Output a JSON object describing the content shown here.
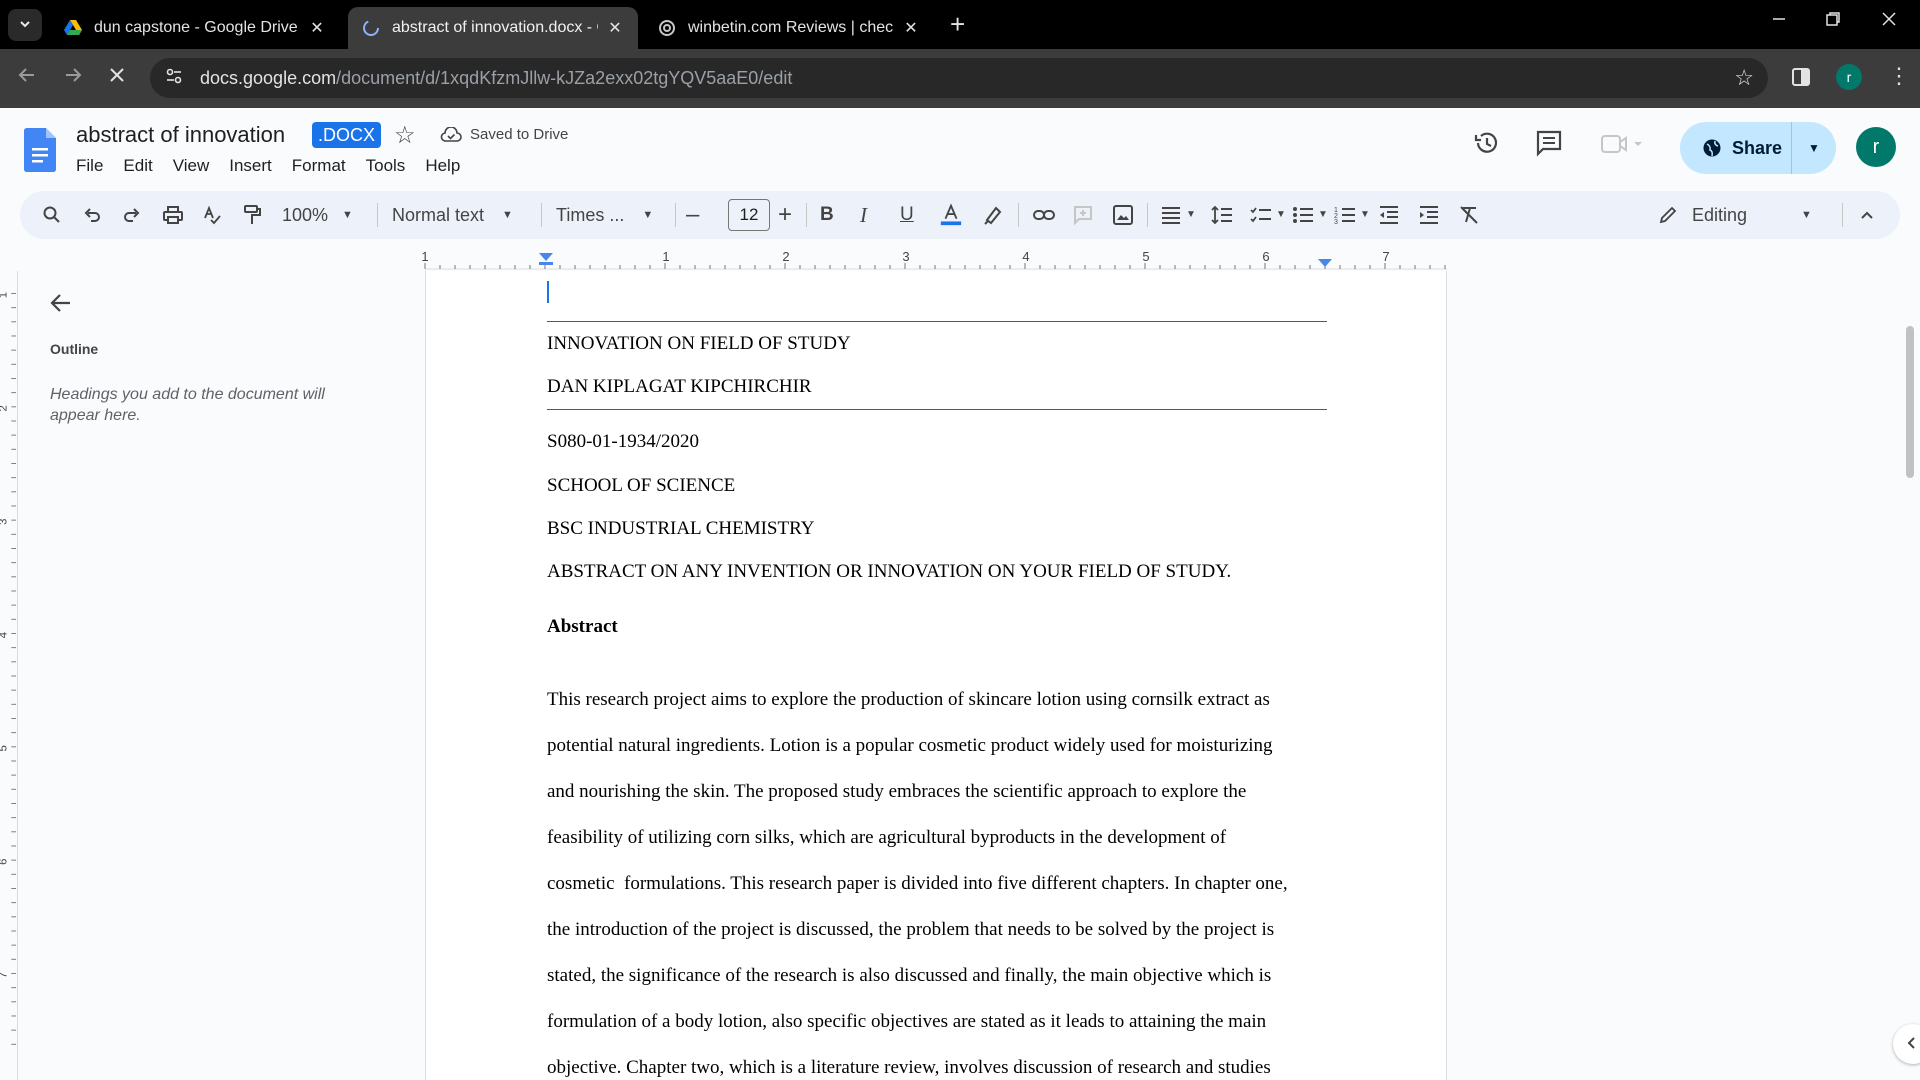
{
  "browser": {
    "tabs": [
      {
        "title": "dun capstone - Google Drive",
        "active": false
      },
      {
        "title": "abstract of innovation.docx - Google Docs",
        "active": true
      },
      {
        "title": "winbetin.com Reviews | check if site is scam or legit",
        "active": false
      }
    ],
    "url_host": "docs.google.com",
    "url_path": "/document/d/1xqdKfzmJllw-kJZa2exx02tgYQV5aaE0/edit",
    "profile_initial": "r"
  },
  "doc_header": {
    "title": "abstract of innovation",
    "badge": ".DOCX",
    "saved_status": "Saved to Drive",
    "menus": [
      "File",
      "Edit",
      "View",
      "Insert",
      "Format",
      "Tools",
      "Help"
    ],
    "share_label": "Share",
    "avatar_initial": "r"
  },
  "toolbar": {
    "zoom": "100%",
    "style": "Normal text",
    "font": "Times ...",
    "font_size": "12",
    "mode": "Editing"
  },
  "ruler": {
    "labels": [
      "1",
      "1",
      "2",
      "3",
      "4",
      "5",
      "6",
      "7"
    ]
  },
  "vruler": {
    "labels": [
      "1",
      "2",
      "3",
      "4",
      "5",
      "6",
      "7"
    ]
  },
  "outline": {
    "title": "Outline",
    "hint": "Headings you add to the document will appear here."
  },
  "document": {
    "title_line": "INNOVATION ON FIELD OF STUDY",
    "author": "DAN KIPLAGAT KIPCHIRCHIR",
    "reg_no": "S080-01-1934/2020",
    "school": "SCHOOL OF SCIENCE",
    "course": "BSC INDUSTRIAL CHEMISTRY",
    "assignment": "ABSTRACT ON ANY INVENTION OR INNOVATION ON YOUR FIELD OF STUDY.",
    "abstract_heading": "Abstract",
    "body_lines": [
      "This research project aims to explore the production of skincare lotion using cornsilk extract as",
      "potential natural ingredients. Lotion is a popular cosmetic product widely used for moisturizing",
      "and nourishing the skin. The proposed study embraces the scientific approach to explore the",
      "feasibility of utilizing corn silks, which are agricultural byproducts in the development of",
      "cosmetic  formulations. This research paper is divided into five different chapters. In chapter one,",
      "the introduction of the project is discussed, the problem that needs to be solved by the project is",
      "stated, the significance of the research is also discussed and finally, the main objective which is",
      "formulation of a body lotion, also specific objectives are stated as it leads to attaining the main",
      "objective. Chapter two, which is a literature review, involves discussion of research and studies"
    ]
  },
  "colors": {
    "accent": "#1a73e8",
    "share_bg": "#c2e7ff",
    "avatar": "#00796b",
    "toolbar_bg": "#edf2fa"
  }
}
